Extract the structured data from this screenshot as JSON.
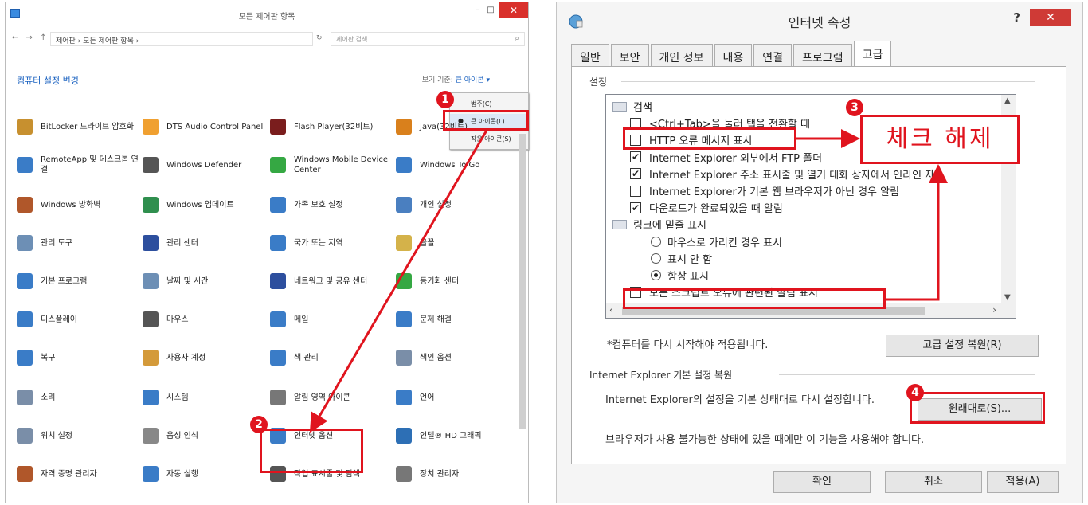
{
  "control_panel": {
    "title": "모든 제어판 항목",
    "nav_arrows": "← → ↑",
    "path": "제어판 › 모든 제어판 항목 ›",
    "search_placeholder": "제어판 검색",
    "heading": "컴퓨터 설정 변경",
    "view_by_label": "보기 기준:",
    "view_by_value": "큰 아이콘 ▾",
    "view_menu": [
      "범주(C)",
      "큰 아이콘(L)",
      "작은 아이콘(S)"
    ],
    "items": [
      {
        "label": "BitLocker 드라이브 암호화",
        "icon": "bitlocker-icon",
        "color": "#c7902f"
      },
      {
        "label": "DTS Audio Control Panel",
        "icon": "dts-icon",
        "color": "#f0a030"
      },
      {
        "label": "Flash Player(32비트)",
        "icon": "flash-icon",
        "color": "#7a1d1d"
      },
      {
        "label": "Java(32비트)",
        "icon": "java-icon",
        "color": "#d9801c"
      },
      {
        "label": "RemoteApp 및 데스크톱 연결",
        "icon": "remoteapp-icon",
        "color": "#3a7cc7"
      },
      {
        "label": "Windows Defender",
        "icon": "defender-icon",
        "color": "#555555"
      },
      {
        "label": "Windows Mobile Device Center",
        "icon": "mobile-center-icon",
        "color": "#35a843"
      },
      {
        "label": "Windows To Go",
        "icon": "to-go-icon",
        "color": "#3a7cc7"
      },
      {
        "label": "Windows 방화벽",
        "icon": "firewall-icon",
        "color": "#b0572a"
      },
      {
        "label": "Windows 업데이트",
        "icon": "update-icon",
        "color": "#2f8f4e"
      },
      {
        "label": "가족 보호 설정",
        "icon": "family-icon",
        "color": "#3a7cc7"
      },
      {
        "label": "개인 설정",
        "icon": "personalize-icon",
        "color": "#4a7fc0"
      },
      {
        "label": "관리 도구",
        "icon": "admin-tools-icon",
        "color": "#6d8fb5"
      },
      {
        "label": "관리 센터",
        "icon": "action-center-icon",
        "color": "#2d4f9e"
      },
      {
        "label": "국가 또는 지역",
        "icon": "region-icon",
        "color": "#3a7cc7"
      },
      {
        "label": "글꼴",
        "icon": "fonts-icon",
        "color": "#d4b24a"
      },
      {
        "label": "기본 프로그램",
        "icon": "default-programs-icon",
        "color": "#3a7cc7"
      },
      {
        "label": "날짜 및 시간",
        "icon": "date-time-icon",
        "color": "#6d8fb5"
      },
      {
        "label": "네트워크 및 공유 센터",
        "icon": "network-icon",
        "color": "#2d4f9e"
      },
      {
        "label": "동기화 센터",
        "icon": "sync-icon",
        "color": "#35a843"
      },
      {
        "label": "디스플레이",
        "icon": "display-icon",
        "color": "#3a7cc7"
      },
      {
        "label": "마우스",
        "icon": "mouse-icon",
        "color": "#555555"
      },
      {
        "label": "메일",
        "icon": "mail-icon",
        "color": "#3a7cc7"
      },
      {
        "label": "문제 해결",
        "icon": "troubleshoot-icon",
        "color": "#3a7cc7"
      },
      {
        "label": "복구",
        "icon": "recovery-icon",
        "color": "#3a7cc7"
      },
      {
        "label": "사용자 계정",
        "icon": "user-accounts-icon",
        "color": "#d49a3a"
      },
      {
        "label": "색 관리",
        "icon": "color-management-icon",
        "color": "#3a7cc7"
      },
      {
        "label": "색인 옵션",
        "icon": "indexing-icon",
        "color": "#7a8ea8"
      },
      {
        "label": "소리",
        "icon": "sound-icon",
        "color": "#7a8ea8"
      },
      {
        "label": "시스템",
        "icon": "system-icon",
        "color": "#3a7cc7"
      },
      {
        "label": "알림 영역 아이콘",
        "icon": "notification-icon",
        "color": "#777777"
      },
      {
        "label": "언어",
        "icon": "language-icon",
        "color": "#3a7cc7"
      },
      {
        "label": "위치 설정",
        "icon": "location-icon",
        "color": "#7a8ea8"
      },
      {
        "label": "음성 인식",
        "icon": "speech-icon",
        "color": "#888888"
      },
      {
        "label": "인터넷 옵션",
        "icon": "internet-options-icon",
        "color": "#3a7cc7"
      },
      {
        "label": "인텔® HD 그래픽",
        "icon": "intel-graphics-icon",
        "color": "#2d6fb5"
      },
      {
        "label": "자격 증명 관리자",
        "icon": "credential-icon",
        "color": "#b0572a"
      },
      {
        "label": "자동 실행",
        "icon": "autoplay-icon",
        "color": "#3a7cc7"
      },
      {
        "label": "작업 표시줄 및 탐색",
        "icon": "taskbar-icon",
        "color": "#555555"
      },
      {
        "label": "장치 관리자",
        "icon": "device-manager-icon",
        "color": "#777777"
      }
    ]
  },
  "internet_options": {
    "title": "인터넷 속성",
    "help": "?",
    "close": "✕",
    "tabs": [
      "일반",
      "보안",
      "개인 정보",
      "내용",
      "연결",
      "프로그램",
      "고급"
    ],
    "settings_group": "설정",
    "settings_rows": [
      {
        "type": "folder",
        "text": "검색"
      },
      {
        "type": "check",
        "checked": false,
        "text": "<Ctrl+Tab>을 눌러 탭을 전환할 때"
      },
      {
        "type": "check",
        "checked": false,
        "text": "HTTP 오류 메시지 표시"
      },
      {
        "type": "check",
        "checked": true,
        "text": "Internet Explorer 외부에서 FTP 폴더"
      },
      {
        "type": "check",
        "checked": true,
        "text": "Internet Explorer 주소 표시줄 및 열기 대화 상자에서 인라인 자"
      },
      {
        "type": "check",
        "checked": false,
        "text": "Internet Explorer가 기본 웹 브라우저가 아닌 경우 알림"
      },
      {
        "type": "check",
        "checked": true,
        "text": "다운로드가 완료되었을 때 알림"
      },
      {
        "type": "folder",
        "text": "링크에 밑줄 표시"
      },
      {
        "type": "radio",
        "checked": false,
        "text": "마우스로 가리킨 경우 표시"
      },
      {
        "type": "radio",
        "checked": false,
        "text": "표시 안 함"
      },
      {
        "type": "radio",
        "checked": true,
        "text": "항상 표시"
      },
      {
        "type": "check",
        "checked": false,
        "text": "모든 스크립트 오류에 관련된 알림 표시"
      }
    ],
    "restart_note": "*컴퓨터를 다시 시작해야 적용됩니다.",
    "restore_advanced": "고급 설정 복원(R)",
    "reset_group": "Internet Explorer 기본 설정 복원",
    "reset_desc": "Internet Explorer의 설정을 기본 상태대로 다시 설정합니다.",
    "reset_button": "원래대로(S)...",
    "reset_warning": "브라우저가 사용 불가능한 상태에 있을 때에만 이 기능을 사용해야 합니다.",
    "ok": "확인",
    "cancel": "취소",
    "apply": "적용(A)"
  },
  "annotations": {
    "step1": "1",
    "step2": "2",
    "step3": "3",
    "step4": "4",
    "callout": "체크 해제",
    "color": "#e0141e"
  }
}
